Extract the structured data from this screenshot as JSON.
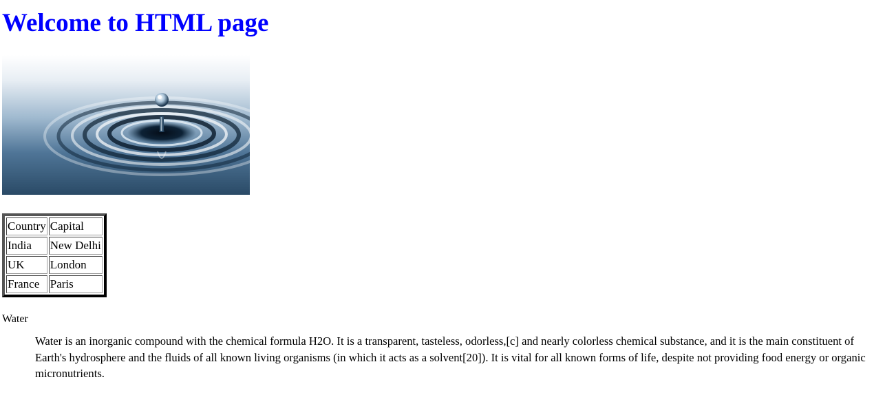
{
  "page": {
    "heading": "Welcome to HTML page",
    "heading_color": "#0000ff"
  },
  "image": {
    "subject": "water-drop-ripple"
  },
  "table": {
    "headers": [
      "Country",
      "Capital"
    ],
    "rows": [
      [
        "India",
        "New Delhi"
      ],
      [
        "UK",
        "London"
      ],
      [
        "France",
        "Paris"
      ]
    ]
  },
  "description": {
    "term": "Water",
    "text": "Water is an inorganic compound with the chemical formula H2O. It is a transparent, tasteless, odorless,[c] and nearly colorless chemical substance, and it is the main constituent of Earth's hydrosphere and the fluids of all known living organisms (in which it acts as a solvent[20]). It is vital for all known forms of life, despite not providing food energy or organic micronutrients."
  }
}
